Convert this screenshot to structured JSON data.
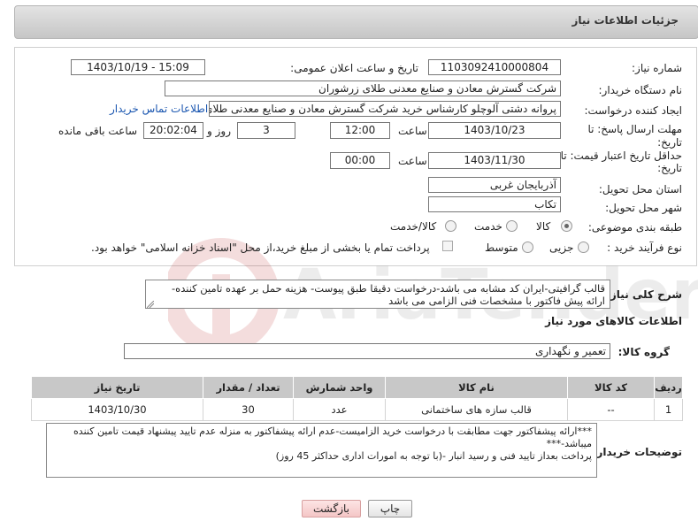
{
  "header": {
    "title": "جزئیات اطلاعات نیاز"
  },
  "form": {
    "need_number_label": "شماره نیاز:",
    "need_number": "1103092410000804",
    "announce_label": "تاریخ و ساعت اعلان عمومی:",
    "announce_value": "1403/10/19 - 15:09",
    "buyer_org_label": "نام دستگاه خریدار:",
    "buyer_org": "شرکت گسترش معادن و صنایع معدنی طلای زرشوران",
    "requester_label": "ایجاد کننده درخواست:",
    "requester": "پروانه  دشتی آلوچلو کارشناس خرید شرکت گسترش معادن و صنایع معدنی طلای زرشوران",
    "contact_link": "اطلاعات تماس خریدار",
    "deadline_label_1": "مهلت ارسال پاسخ: تا",
    "deadline_label_2": "تاریخ:",
    "deadline_date": "1403/10/23",
    "time_label": "ساعت",
    "deadline_time": "12:00",
    "days_value": "3",
    "days_label": "روز و",
    "remaining_time": "20:02:04",
    "remaining_label": "ساعت باقی مانده",
    "validity_label_1": "حداقل تاریخ اعتبار قیمت: تا",
    "validity_label_2": "تاریخ:",
    "validity_date": "1403/11/30",
    "validity_time_label": "ساعت",
    "validity_time": "00:00",
    "province_label": "استان محل تحویل:",
    "province": "آذربایجان غربی",
    "city_label": "شهر محل تحویل:",
    "city": "تکاب",
    "category_label": "طبقه بندی موضوعی:",
    "category_options": [
      "کالا",
      "خدمت",
      "کالا/خدمت"
    ],
    "purchase_label": "نوع فرآیند خرید :",
    "purchase_options": [
      "جزیی",
      "متوسط"
    ],
    "treasury_note": "پرداخت تمام یا بخشی از مبلغ خرید،از محل \"اسناد خزانه اسلامی\" خواهد بود."
  },
  "description": {
    "label": "شرح کلی نیاز:",
    "text": "قالب گرافیتی-ایران کد مشابه می باشد-درخواست دقیقا طبق پیوست- هزینه حمل بر عهده تامین کننده- ارائه پیش فاکتور با مشخصات فنی الزامی می باشد"
  },
  "goods": {
    "section_title": "اطلاعات کالاهای مورد نیاز",
    "group_label": "گروه کالا:",
    "group_value": "تعمیر و نگهداری"
  },
  "table": {
    "headers": [
      "ردیف",
      "کد کالا",
      "نام کالا",
      "واحد شمارش",
      "تعداد / مقدار",
      "تاریخ نیاز"
    ],
    "rows": [
      [
        "1",
        "--",
        "قالب سازه های ساختمانی",
        "عدد",
        "30",
        "1403/10/30"
      ]
    ]
  },
  "buyer_notes": {
    "label": "توضیحات خریدار:",
    "line1": "***ارائه پیشفاکتور جهت مطابقت با درخواست خرید الزامیست-عدم ارائه پیشفاکتور به منزله عدم تایید پیشنهاد قیمت تامین کننده میباشد-***",
    "line2": "پرداخت بعداز تایید فنی و رسید انبار -(با توجه به امورات اداری حداکثر 45 روز)"
  },
  "buttons": {
    "print": "چاپ",
    "back": "بازگشت"
  },
  "colors": {
    "link": "#1a56b0",
    "back_button_bg": "#f9d7d7",
    "header_bg": "#d4d4d4"
  }
}
